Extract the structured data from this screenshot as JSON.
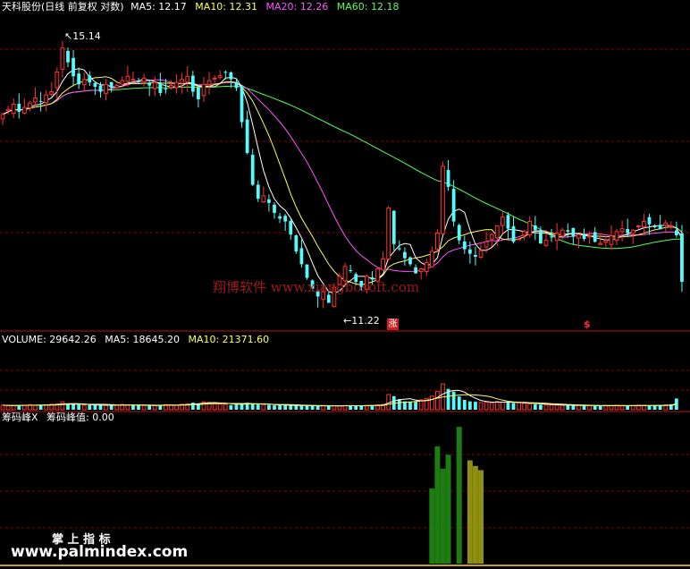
{
  "panel_main": {
    "title": "天科股份(日线 前复权 对数)",
    "ma_labels": [
      {
        "label": "MA5: 12.17",
        "color": "#ffffff"
      },
      {
        "label": "MA10: 12.31",
        "color": "#ffff55"
      },
      {
        "label": "MA20: 12.26",
        "color": "#ff55ff"
      },
      {
        "label": "MA60: 12.18",
        "color": "#55ff55"
      }
    ],
    "high_label": "15.14",
    "low_label": "11.22",
    "marker_zhang": "涨",
    "marker_s": "$",
    "watermark": "翔博软件 www.xiangbosoft.com"
  },
  "panel_volume": {
    "labels": [
      {
        "label": "VOLUME: 29642.26",
        "color": "#ffffff"
      },
      {
        "label": "MA5: 18645.20",
        "color": "#ffffff"
      },
      {
        "label": "MA10: 21371.60",
        "color": "#ffff55"
      }
    ]
  },
  "panel_indicator": {
    "title": "筹码峰X",
    "value_label": "筹码峰值: 0.00"
  },
  "branding": {
    "line1": "掌 上 指 标",
    "line2": "www.palmindex.com"
  },
  "colors": {
    "up": "#ff3232",
    "down": "#54fcfc",
    "ma5": "#ffffff",
    "ma10": "#ffff55",
    "ma20": "#ff55ff",
    "ma60": "#55ff55",
    "grid": "#8b0000",
    "green_bar": "#1e7d12",
    "olive_bar": "#8f8f12"
  },
  "chart_data": {
    "type": "candlestick",
    "price_range": [
      10.95,
      15.6
    ],
    "high": 15.14,
    "low": 11.22,
    "closes": [
      13.94,
      14.02,
      14.1,
      13.98,
      14.05,
      14.12,
      14.2,
      14.15,
      14.25,
      14.3,
      14.62,
      15.02,
      14.78,
      14.55,
      14.42,
      14.5,
      14.45,
      14.38,
      14.3,
      14.42,
      14.36,
      14.4,
      14.48,
      14.55,
      14.5,
      14.46,
      14.52,
      14.4,
      14.45,
      14.28,
      14.34,
      14.4,
      14.45,
      14.5,
      14.55,
      14.3,
      14.18,
      14.42,
      14.48,
      14.52,
      14.56,
      14.62,
      14.5,
      14.36,
      13.82,
      13.35,
      12.88,
      12.68,
      12.72,
      12.62,
      12.48,
      12.4,
      12.36,
      12.18,
      11.95,
      11.78,
      11.6,
      11.46,
      11.36,
      11.42,
      11.28,
      11.48,
      11.62,
      11.75,
      11.7,
      11.55,
      11.48,
      11.62,
      11.58,
      11.72,
      11.85,
      12.55,
      12.05,
      11.98,
      11.86,
      11.78,
      11.66,
      11.72,
      11.8,
      11.95,
      12.2,
      13.15,
      12.85,
      12.36,
      12.1,
      11.98,
      11.92,
      11.88,
      11.96,
      12.08,
      12.18,
      12.3,
      12.42,
      12.26,
      12.08,
      12.12,
      12.22,
      12.36,
      12.24,
      12.06,
      12.1,
      12.15,
      12.2,
      12.24,
      12.22,
      12.15,
      12.18,
      12.12,
      12.16,
      12.08,
      12.06,
      12.1,
      12.16,
      12.22,
      12.26,
      12.2,
      12.24,
      12.3,
      12.36,
      12.32,
      12.28,
      12.25,
      12.34,
      12.3,
      12.17,
      11.55
    ],
    "volume_range": [
      0,
      165000
    ],
    "volumes": [
      12000,
      11000,
      10500,
      12500,
      11800,
      13500,
      12000,
      12800,
      13000,
      14500,
      15500,
      21000,
      16500,
      14200,
      13000,
      11800,
      12500,
      12000,
      12600,
      11500,
      12200,
      12000,
      14000,
      12800,
      12000,
      11500,
      11000,
      11800,
      10800,
      12200,
      13500,
      12600,
      11500,
      14500,
      15500,
      18800,
      17000,
      21000,
      19500,
      17500,
      15000,
      14000,
      12500,
      13800,
      16500,
      18500,
      15200,
      14000,
      13500,
      12500,
      11500,
      12200,
      11500,
      10800,
      11000,
      10000,
      11500,
      10000,
      9500,
      10500,
      11000,
      10500,
      9800,
      11000,
      11800,
      10500,
      10000,
      11200,
      12500,
      13000,
      14000,
      40000,
      36000,
      28000,
      22000,
      20000,
      21000,
      26000,
      30000,
      36000,
      48000,
      68000,
      55000,
      48000,
      35000,
      26000,
      22000,
      21000,
      19000,
      20000,
      18500,
      22000,
      20500,
      19000,
      17500,
      18200,
      16800,
      15500,
      14500,
      13500,
      13000,
      12500,
      12000,
      11500,
      12000,
      11000,
      11500,
      10500,
      11000,
      10000,
      10500,
      11200,
      10800,
      11500,
      10200,
      10800,
      11000,
      12000,
      11500,
      10000,
      11000,
      12500,
      13000,
      14500,
      29642
    ],
    "indicator": {
      "type": "bar",
      "range": [
        0,
        1
      ],
      "green_bars": [
        {
          "i": 79,
          "v": 0.54
        },
        {
          "i": 80,
          "v": 0.84
        },
        {
          "i": 81,
          "v": 0.68
        },
        {
          "i": 82,
          "v": 0.78
        },
        {
          "i": 84,
          "v": 0.98
        }
      ],
      "olive_bars": [
        {
          "i": 86,
          "v": 0.74
        },
        {
          "i": 87,
          "v": 0.7
        },
        {
          "i": 88,
          "v": 0.67
        }
      ]
    }
  }
}
